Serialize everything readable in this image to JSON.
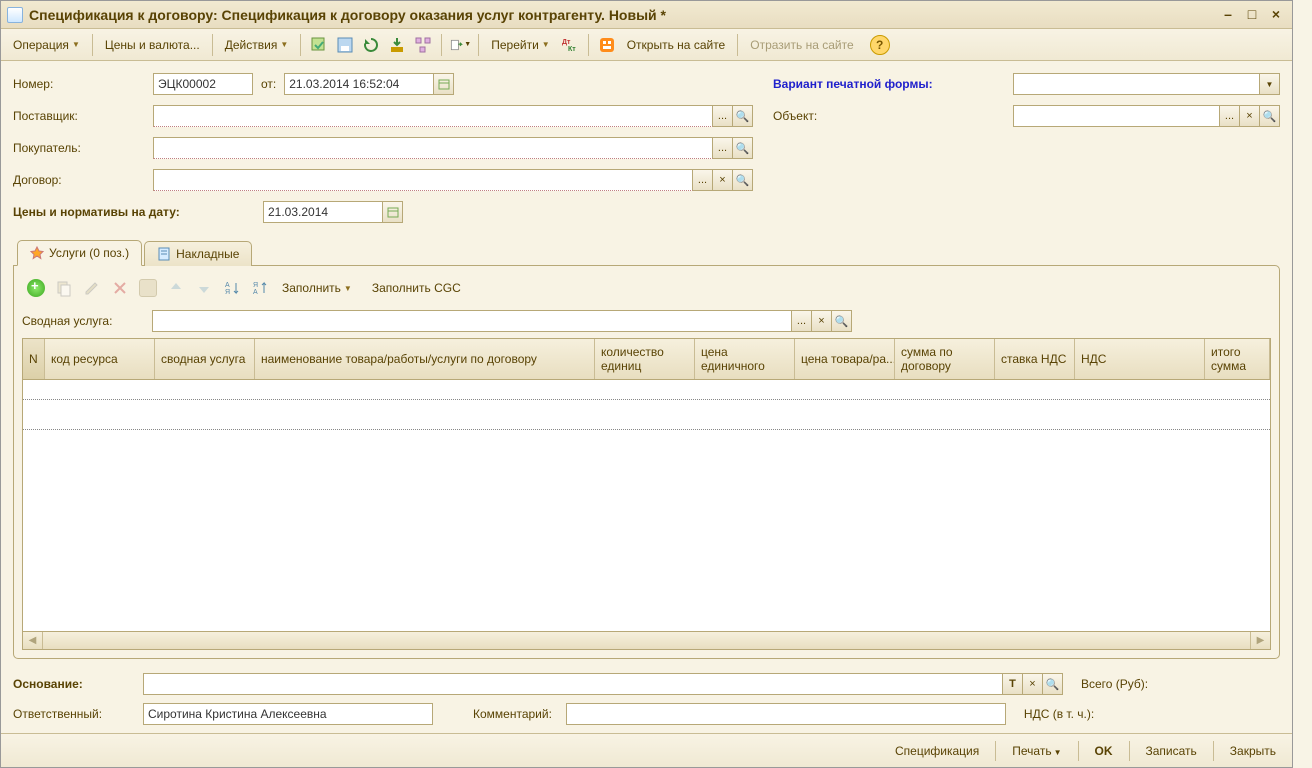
{
  "titlebar": {
    "title": "Спецификация к договору: Спецификация к договору оказания услуг контрагенту. Новый *"
  },
  "toolbar": {
    "operation": "Операция",
    "prices": "Цены и валюта...",
    "actions": "Действия",
    "goto": "Перейти",
    "open_site": "Открыть на сайте",
    "reflect_site": "Отразить на сайте"
  },
  "form": {
    "number_label": "Номер:",
    "number_value": "ЭЦК00002",
    "from_label": "от:",
    "date_value": "21.03.2014 16:52:04",
    "supplier_label": "Поставщик:",
    "supplier_value": "",
    "buyer_label": "Покупатель:",
    "buyer_value": "",
    "contract_label": "Договор:",
    "contract_value": "",
    "prices_date_label": "Цены и нормативы на дату:",
    "prices_date_value": "21.03.2014",
    "variant_label": "Вариант печатной формы:",
    "variant_value": "",
    "object_label": "Объект:",
    "object_value": ""
  },
  "tabs": {
    "services": "Услуги (0 поз.)",
    "invoices": "Накладные"
  },
  "tabToolbar": {
    "fill": "Заполнить",
    "fill_cgc": "Заполнить CGC"
  },
  "summaryService": {
    "label": "Сводная услуга:",
    "value": ""
  },
  "columns": [
    "N",
    "код ресурса",
    "сводная услуга",
    "наименование товара/работы/услуги по договору",
    "количество единиц",
    "цена единичного",
    "цена товара/ра...",
    "сумма по договору",
    "ставка НДС",
    "НДС",
    "итого сумма"
  ],
  "footer": {
    "basis_label": "Основание:",
    "basis_value": "",
    "responsible_label": "Ответственный:",
    "responsible_value": "Сиротина Кристина Алексеевна",
    "comment_label": "Комментарий:",
    "comment_value": "",
    "total_label": "Всего (Руб):",
    "vat_label": "НДС (в т. ч.):"
  },
  "buttons": {
    "spec": "Спецификация",
    "print": "Печать",
    "ok": "OK",
    "save": "Записать",
    "close": "Закрыть"
  }
}
